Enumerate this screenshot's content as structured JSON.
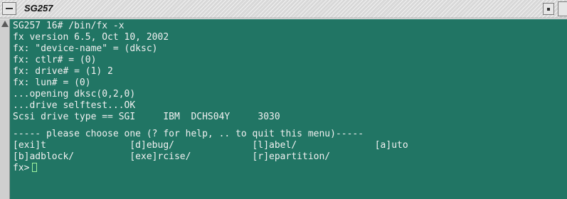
{
  "window": {
    "title": "SG257"
  },
  "icons": {
    "window_menu": "window-menu-icon",
    "iconify": "iconify-icon",
    "maximize": "maximize-icon",
    "scroll_up": "scroll-up-arrow-icon"
  },
  "colors": {
    "terminal_bg": "#217564",
    "terminal_fg": "#f0f0f0",
    "cursor": "#9ef5a0"
  },
  "terminal": {
    "lines": [
      "SG257 16# /bin/fx -x",
      "fx version 6.5, Oct 10, 2002",
      "fx: \"device-name\" = (dksc)",
      "fx: ctlr# = (0)",
      "fx: drive# = (1) 2",
      "fx: lun# = (0)",
      "...opening dksc(0,2,0)",
      "...drive selftest...OK",
      "Scsi drive type == SGI     IBM  DCHS04Y     3030",
      "",
      "----- please choose one (? for help, .. to quit this menu)-----",
      "[exi]t               [d]ebug/              [l]abel/              [a]uto",
      "[b]adblock/          [exe]rcise/           [r]epartition/"
    ],
    "prompt": "fx>"
  }
}
